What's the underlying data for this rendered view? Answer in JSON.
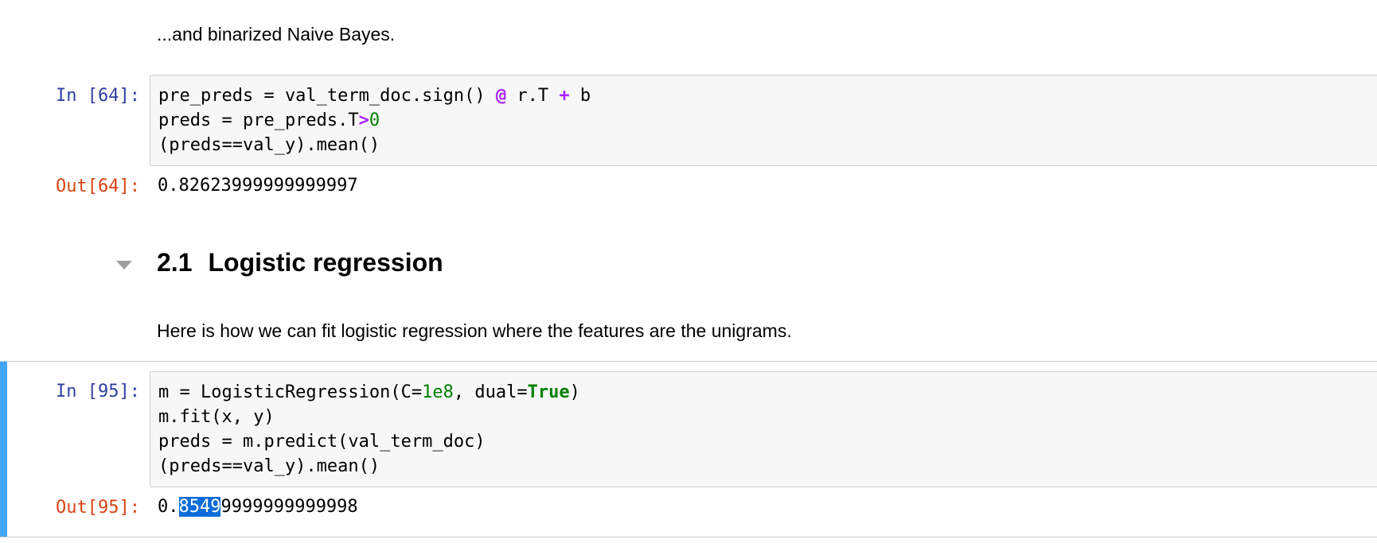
{
  "cells": {
    "md1_text": "...and binarized Naive Bayes.",
    "cell64": {
      "in_prompt": "In [64]:",
      "out_prompt": "Out[64]:",
      "output": "0.82623999999999997"
    },
    "heading": {
      "number": "2.1",
      "title": "Logistic regression"
    },
    "md2_text": "Here is how we can fit logistic regression where the features are the unigrams.",
    "cell95": {
      "in_prompt": "In [95]:",
      "out_prompt": "Out[95]:",
      "output_prefix": "0.",
      "output_selected": "8549",
      "output_suffix": "9999999999998"
    }
  },
  "code64": {
    "l1_a": "pre_preds = val_term_doc.sign() ",
    "l1_op1": "@",
    "l1_b": " r.T ",
    "l1_op2": "+",
    "l1_c": " b",
    "l2_a": "preds = pre_preds.T",
    "l2_op": ">",
    "l2_num": "0",
    "l3": "(preds==val_y).mean()"
  },
  "code95": {
    "l1_a": "m = LogisticRegression(C=",
    "l1_num": "1e8",
    "l1_b": ", dual=",
    "l1_kw": "True",
    "l1_c": ")",
    "l2": "m.fit(x, y)",
    "l3": "preds = m.predict(val_term_doc)",
    "l4": "(preds==val_y).mean()"
  },
  "colors": {
    "in_prompt": "#303F9F",
    "out_prompt": "#D84315",
    "selected_cell_bar": "#42A5F5",
    "text_selection": "#0a6dd9",
    "keyword": "#008000",
    "operator": "#AA22FF"
  },
  "icons": {
    "heading_collapse": "caret-down-icon"
  }
}
